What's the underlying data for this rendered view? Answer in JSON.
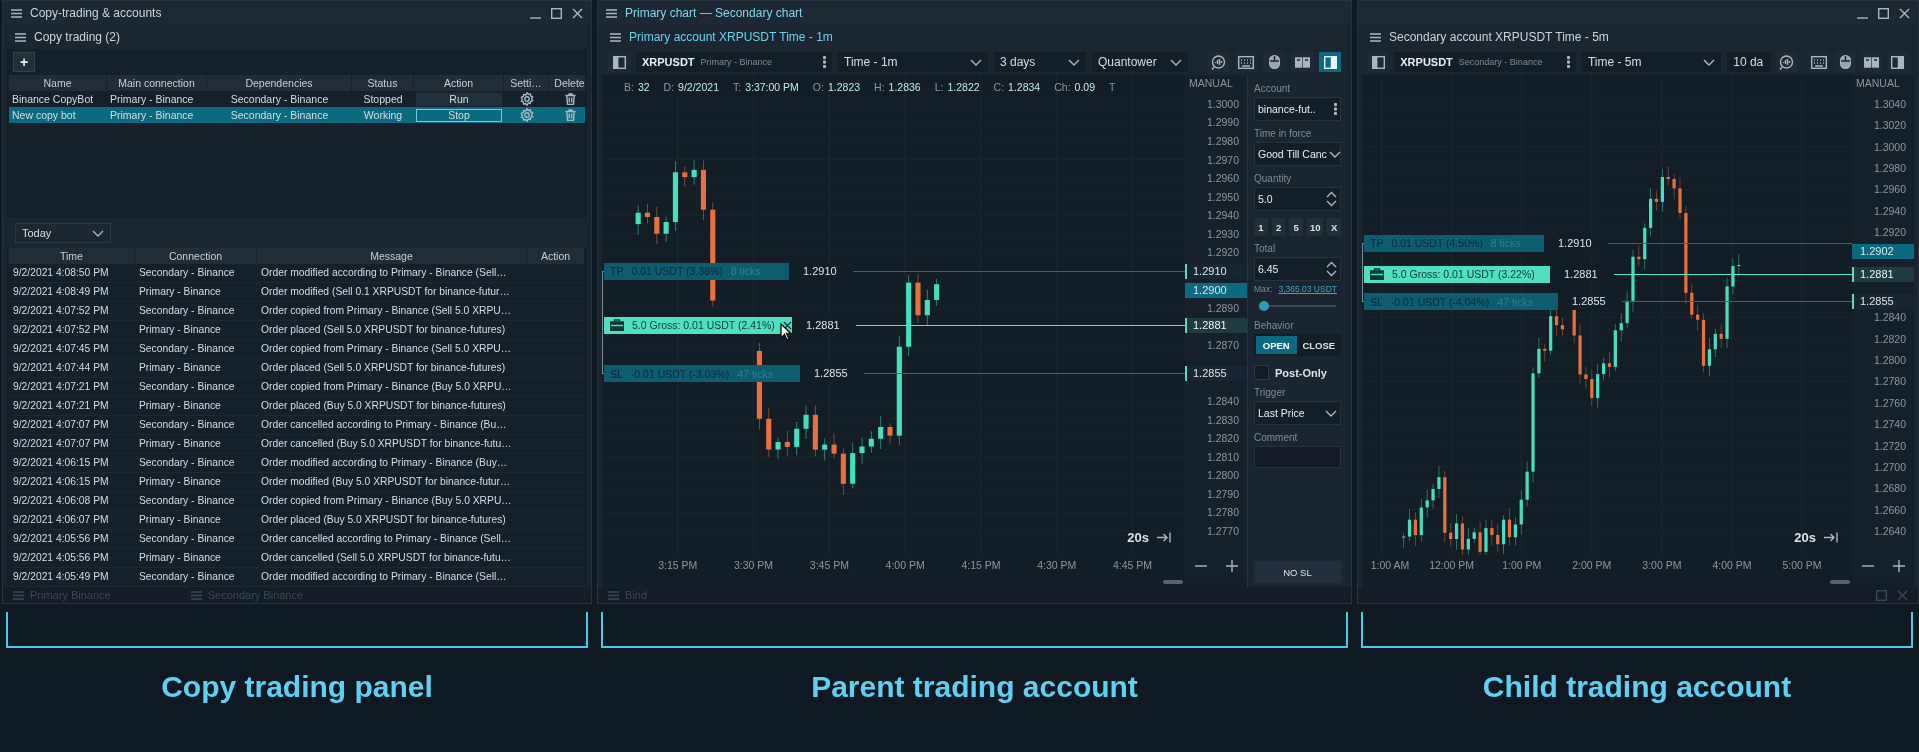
{
  "copy_window": {
    "title": "Copy-trading & accounts",
    "panel_title": "Copy trading (2)",
    "add_button": "+",
    "bots_table": {
      "columns": [
        "Name",
        "Main connection",
        "Dependencies",
        "Status",
        "Action",
        "Setti…",
        "Delete"
      ],
      "rows": [
        {
          "name": "Binance CopyBot",
          "main_connection": "Primary - Binance",
          "dependencies": "Secondary - Binance",
          "status": "Stopped",
          "action": "Run",
          "selected": false
        },
        {
          "name": "New copy bot",
          "main_connection": "Primary - Binance",
          "dependencies": "Secondary - Binance",
          "status": "Working",
          "action": "Stop",
          "selected": true
        }
      ]
    },
    "period_dropdown": "Today",
    "log_table": {
      "columns": [
        "Time",
        "Connection",
        "Message",
        "Action"
      ],
      "rows": [
        {
          "time": "9/2/2021 4:08:50 PM",
          "connection": "Secondary - Binance",
          "message": "Order modified according to Primary - Binance (Sell…"
        },
        {
          "time": "9/2/2021 4:08:49 PM",
          "connection": "Primary - Binance",
          "message": "Order modified (Sell 0.1 XRPUSDT for binance-futur…"
        },
        {
          "time": "9/2/2021 4:07:52 PM",
          "connection": "Secondary - Binance",
          "message": "Order copied from Primary - Binance (Sell 5.0 XRPU…"
        },
        {
          "time": "9/2/2021 4:07:52 PM",
          "connection": "Primary - Binance",
          "message": "Order placed (Sell 5.0 XRPUSDT for binance-futures)"
        },
        {
          "time": "9/2/2021 4:07:45 PM",
          "connection": "Secondary - Binance",
          "message": "Order copied from Primary - Binance (Sell 5.0 XRPU…"
        },
        {
          "time": "9/2/2021 4:07:44 PM",
          "connection": "Primary - Binance",
          "message": "Order placed (Sell 5.0 XRPUSDT for binance-futures)"
        },
        {
          "time": "9/2/2021 4:07:21 PM",
          "connection": "Secondary - Binance",
          "message": "Order copied from Primary - Binance (Buy 5.0 XRPU…"
        },
        {
          "time": "9/2/2021 4:07:21 PM",
          "connection": "Primary - Binance",
          "message": "Order placed (Buy 5.0 XRPUSDT for binance-futures)"
        },
        {
          "time": "9/2/2021 4:07:07 PM",
          "connection": "Secondary - Binance",
          "message": "Order cancelled according to Primary - Binance (Bu…"
        },
        {
          "time": "9/2/2021 4:07:07 PM",
          "connection": "Primary - Binance",
          "message": "Order cancelled (Buy 5.0 XRPUSDT for binance-futu…"
        },
        {
          "time": "9/2/2021 4:06:15 PM",
          "connection": "Secondary - Binance",
          "message": "Order modified according to Primary - Binance (Buy…"
        },
        {
          "time": "9/2/2021 4:06:15 PM",
          "connection": "Primary - Binance",
          "message": "Order modified (Buy 5.0 XRPUSDT for binance-futur…"
        },
        {
          "time": "9/2/2021 4:06:08 PM",
          "connection": "Secondary - Binance",
          "message": "Order copied from Primary - Binance (Buy 5.0 XRPU…"
        },
        {
          "time": "9/2/2021 4:06:07 PM",
          "connection": "Primary - Binance",
          "message": "Order placed (Buy 5.0 XRPUSDT for binance-futures)"
        },
        {
          "time": "9/2/2021 4:05:56 PM",
          "connection": "Secondary - Binance",
          "message": "Order cancelled according to Primary - Binance (Sell…"
        },
        {
          "time": "9/2/2021 4:05:56 PM",
          "connection": "Primary - Binance",
          "message": "Order cancelled (Sell 5.0 XRPUSDT for binance-futu…"
        },
        {
          "time": "9/2/2021 4:05:49 PM",
          "connection": "Secondary - Binance",
          "message": "Order modified according to Primary - Binance (Sell…"
        }
      ]
    },
    "docked_tabs": [
      "Primary Binance",
      "Secondary Binance"
    ]
  },
  "primary_window": {
    "title": "Primary chart — Secondary chart",
    "chart": {
      "header": "Primary account XRPUSDT Time - 1m",
      "symbol": "XRPUSDT",
      "connection": "Primary - Binance",
      "timeframe": "Time - 1m",
      "period": "3 days",
      "template": "Quantower",
      "info": [
        {
          "label": "B:",
          "value": "32"
        },
        {
          "label": "D:",
          "value": "9/2/2021"
        },
        {
          "label": "T:",
          "value": "3:37:00 PM"
        },
        {
          "label": "O:",
          "value": "1.2823"
        },
        {
          "label": "H:",
          "value": "1.2836"
        },
        {
          "label": "L:",
          "value": "1.2822"
        },
        {
          "label": "C:",
          "value": "1.2834"
        },
        {
          "label": "Ch:",
          "value": "0.09"
        },
        {
          "label": "T"
        }
      ],
      "scale_mode": "MANUAL",
      "ticks": [
        "1.3000",
        "1.2990",
        "1.2980",
        "1.2970",
        "1.2960",
        "1.2950",
        "1.2940",
        "1.2930",
        "1.2920",
        "1.2890",
        "1.2870",
        "1.2840",
        "1.2830",
        "1.2820",
        "1.2810",
        "1.2800",
        "1.2790",
        "1.2780",
        "1.2770"
      ],
      "axis_tags": [
        {
          "price": "1.2910",
          "kind": "line"
        },
        {
          "price": "1.2900",
          "kind": "last"
        },
        {
          "price": "1.2881",
          "kind": "position"
        },
        {
          "price": "1.2855",
          "kind": "line"
        }
      ],
      "order_lines": [
        {
          "kind": "tp",
          "tag": "TP",
          "pnl": "0.01 USDT (3.38%)",
          "ticks": "8 ticks",
          "price": "1.2910"
        },
        {
          "kind": "position",
          "pnl": "5.0 Gross: 0.01 USDT (2.41%)",
          "price": "1.2881",
          "closable": true
        },
        {
          "kind": "sl",
          "tag": "SL",
          "pnl": "-0.01 USDT (-3.03%)",
          "ticks": "47 ticks",
          "price": "1.2855"
        }
      ],
      "times": [
        "3:15 PM",
        "3:30 PM",
        "3:45 PM",
        "4:00 PM",
        "4:15 PM",
        "4:30 PM",
        "4:45 PM"
      ],
      "zoom_label": "20s"
    },
    "order_panel": {
      "account_label": "Account",
      "account": "binance-fut..",
      "tif_label": "Time in force",
      "tif": "Good Till Canc",
      "quantity_label": "Quantity",
      "quantity": "5.0",
      "quick_quantities": [
        "1",
        "2",
        "5",
        "10",
        "X"
      ],
      "total_label": "Total",
      "total": "6.45",
      "max_label": "Max:",
      "max_value": "3,365.03 USDT",
      "slider": {
        "level": 0
      },
      "behavior_label": "Behavior",
      "behavior": [
        {
          "label": "OPEN",
          "selected": true
        },
        {
          "label": "CLOSE",
          "selected": false
        }
      ],
      "post_only": {
        "label": "Post-Only",
        "checked": false
      },
      "trigger_label": "Trigger",
      "trigger": "Last Price",
      "comment_label": "Comment",
      "no_sl_button": "NO SL"
    },
    "docked_tab": "Bind"
  },
  "secondary_window": {
    "chart": {
      "header": "Secondary account XRPUSDT Time - 5m",
      "symbol": "XRPUSDT",
      "connection": "Secondary - Binance",
      "timeframe": "Time - 5m",
      "period": "10 da",
      "scale_mode": "MANUAL",
      "ticks": [
        "1.3040",
        "1.3020",
        "1.3000",
        "1.2980",
        "1.2960",
        "1.2940",
        "1.2920",
        "1.2840",
        "1.2820",
        "1.2800",
        "1.2780",
        "1.2760",
        "1.2740",
        "1.2720",
        "1.2700",
        "1.2680",
        "1.2660",
        "1.2640"
      ],
      "axis_tags": [
        {
          "price": "1.2902",
          "kind": "last"
        },
        {
          "price": "1.2881",
          "kind": "position"
        },
        {
          "price": "1.2855",
          "kind": "line"
        }
      ],
      "order_lines": [
        {
          "kind": "tp",
          "tag": "TP",
          "pnl": "0.01 USDT (4.50%)",
          "ticks": "8 ticks",
          "price": "1.2910"
        },
        {
          "kind": "position",
          "pnl": "5.0 Gross: 0.01 USDT (3.22%)",
          "price": "1.2881",
          "closable": false
        },
        {
          "kind": "sl",
          "tag": "SL",
          "pnl": "-0.01 USDT (-4.04%)",
          "ticks": "47 ticks",
          "price": "1.2855"
        }
      ],
      "times": [
        "1:00 AM",
        "12:00 PM",
        "1:00 PM",
        "2:00 PM",
        "3:00 PM",
        "4:00 PM",
        "5:00 PM"
      ],
      "zoom_label": "20s"
    }
  },
  "captions": [
    "Copy trading panel",
    "Parent trading account",
    "Child trading account"
  ]
}
